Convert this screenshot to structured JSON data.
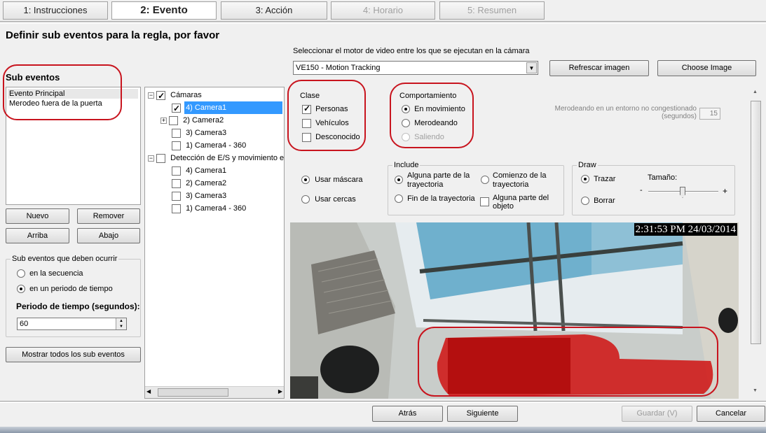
{
  "tabs": [
    {
      "label": "1: Instrucciones",
      "state": "normal"
    },
    {
      "label": "2: Evento",
      "state": "active"
    },
    {
      "label": "3: Acción",
      "state": "normal"
    },
    {
      "label": "4: Horario",
      "state": "disabled"
    },
    {
      "label": "5: Resumen",
      "state": "disabled"
    }
  ],
  "page": {
    "heading": "Definir sub eventos para la regla, por favor"
  },
  "engine": {
    "label": "Seleccionar el motor de video entre los que se ejecutan en la cámara",
    "selected": "VE150 - Motion Tracking",
    "refresh_button": "Refrescar imagen",
    "choose_button": "Choose Image"
  },
  "sub_events": {
    "title": "Sub eventos",
    "items": [
      "Evento Principal",
      "Merodeo fuera de la puerta"
    ],
    "buttons": {
      "new": "Nuevo",
      "remove": "Remover",
      "up": "Arriba",
      "down": "Abajo"
    },
    "must_occur_title": "Sub eventos que deben ocurrir",
    "in_sequence": "en la secuencia",
    "in_period": "en un periodo de tiempo",
    "period_label": "Periodo de tiempo (segundos):",
    "period_value": "60",
    "show_all_button": "Mostrar todos los sub eventos"
  },
  "tree": {
    "cameras_label": "Cámaras",
    "cameras": [
      "4) Camera1",
      "2) Camera2",
      "3) Camera3",
      "1) Camera4 - 360"
    ],
    "detection_label": "Detección de E/S y movimiento e",
    "detection": [
      "4) Camera1",
      "2) Camera2",
      "3) Camera3",
      "1) Camera4 - 360"
    ]
  },
  "clase": {
    "title": "Clase",
    "items": [
      {
        "label": "Personas",
        "checked": true
      },
      {
        "label": "Vehículos",
        "checked": false
      },
      {
        "label": "Desconocido",
        "checked": false
      }
    ]
  },
  "comportamiento": {
    "title": "Comportamiento",
    "items": [
      {
        "label": "En movimiento",
        "selected": true,
        "disabled": false
      },
      {
        "label": "Merodeando",
        "selected": false,
        "disabled": false
      },
      {
        "label": "Saliendo",
        "selected": false,
        "disabled": true
      }
    ]
  },
  "loiter": {
    "label": "Merodeando en un entorno no congestionado (segundos)",
    "value": "15"
  },
  "mask": {
    "use_mask": "Usar máscara",
    "use_fences": "Usar cercas"
  },
  "include": {
    "title": "Include",
    "any_part": "Alguna parte de la trayectoria",
    "start": "Comienzo de la trayectoria",
    "end": "Fin de la trayectoria",
    "any_object": "Alguna parte del objeto"
  },
  "draw": {
    "title": "Draw",
    "trace": "Trazar",
    "erase": "Borrar",
    "size_label": "Tamaño:",
    "minus": "-",
    "plus": "+"
  },
  "camera_image": {
    "timestamp": "2:31:53 PM 24/03/2014"
  },
  "footer": {
    "back": "Atrás",
    "next": "Siguiente",
    "save": "Guardar (V)",
    "cancel": "Cancelar"
  },
  "colors": {
    "selection": "#3399ff",
    "annotation_red": "#c8141e",
    "mask_red": "#d01010"
  }
}
